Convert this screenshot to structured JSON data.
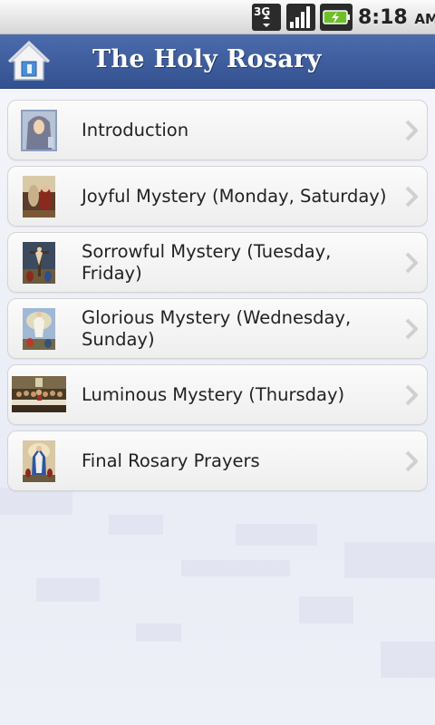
{
  "status_bar": {
    "network_icon": "3g-data-icon",
    "network_label": "3G",
    "signal_icon": "signal-bars-icon",
    "battery_icon": "battery-charging-icon",
    "time": "8:18",
    "ampm": "AM"
  },
  "header": {
    "home_icon": "home-icon",
    "title": "The Holy Rosary",
    "bar_color": "#3f5d9e"
  },
  "menu": {
    "items": [
      {
        "label": "Introduction",
        "thumb_icon": "madonna-portrait-icon"
      },
      {
        "label": "Joyful Mystery (Monday, Saturday)",
        "thumb_icon": "annunciation-painting-icon"
      },
      {
        "label": "Sorrowful Mystery (Tuesday, Friday)",
        "thumb_icon": "crucifixion-painting-icon"
      },
      {
        "label": "Glorious Mystery (Wednesday, Sunday)",
        "thumb_icon": "resurrection-painting-icon"
      },
      {
        "label": "Luminous Mystery (Thursday)",
        "thumb_icon": "last-supper-painting-icon"
      },
      {
        "label": "Final Rosary Prayers",
        "thumb_icon": "mary-statue-painting-icon"
      }
    ],
    "chevron_icon": "chevron-right-icon"
  }
}
